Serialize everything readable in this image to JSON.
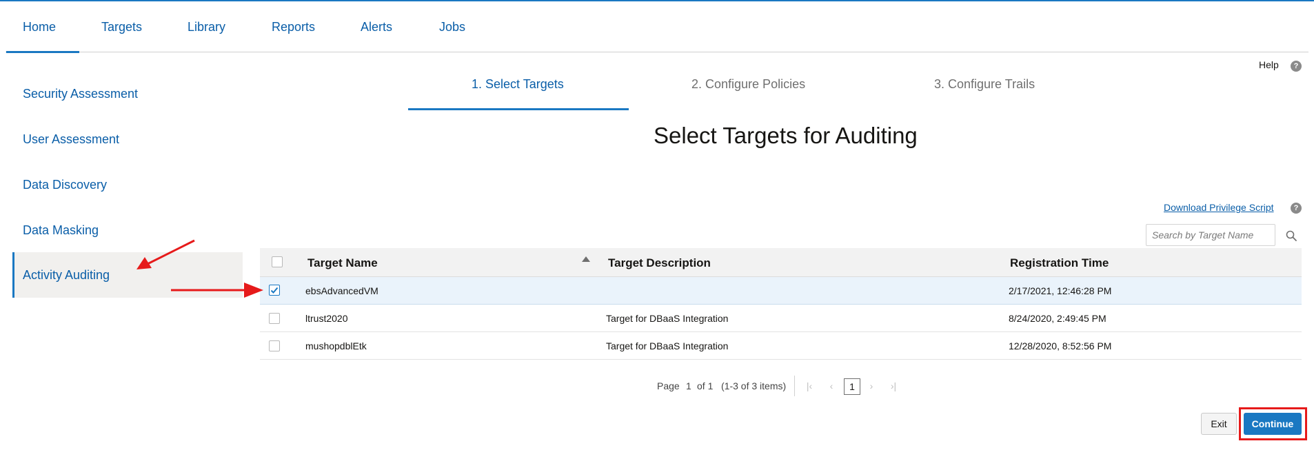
{
  "colors": {
    "accent": "#1a78c2",
    "link": "#0a5ea8",
    "annotation": "#e61a1a"
  },
  "nav": {
    "tabs": [
      {
        "label": "Home"
      },
      {
        "label": "Targets"
      },
      {
        "label": "Library"
      },
      {
        "label": "Reports"
      },
      {
        "label": "Alerts"
      },
      {
        "label": "Jobs"
      }
    ],
    "active": "Home"
  },
  "help": {
    "label": "Help",
    "icon": "help-icon"
  },
  "sidebar": {
    "items": [
      {
        "label": "Security Assessment"
      },
      {
        "label": "User Assessment"
      },
      {
        "label": "Data Discovery"
      },
      {
        "label": "Data Masking"
      },
      {
        "label": "Activity Auditing"
      }
    ],
    "active": "Activity Auditing"
  },
  "wizard": {
    "steps": [
      {
        "label": "1. Select Targets"
      },
      {
        "label": "2. Configure Policies"
      },
      {
        "label": "3. Configure Trails"
      }
    ],
    "active_step": 1
  },
  "main": {
    "title": "Select Targets for Auditing",
    "download_link": "Download Privilege Script",
    "search_placeholder": "Search by Target Name"
  },
  "table": {
    "headers": [
      "Target Name",
      "Target Description",
      "Registration Time"
    ],
    "sort_column": "Target Name",
    "sort_direction": "ascending",
    "rows": [
      {
        "name": "ebsAdvancedVM",
        "description": "",
        "time": "2/17/2021, 12:46:28 PM",
        "checked": true
      },
      {
        "name": "ltrust2020",
        "description": "Target for DBaaS Integration",
        "time": "8/24/2020, 2:49:45 PM",
        "checked": false
      },
      {
        "name": "mushopdblEtk",
        "description": "Target for DBaaS Integration",
        "time": "12/28/2020, 8:52:56 PM",
        "checked": false
      }
    ]
  },
  "pagination": {
    "page_label": "Page",
    "page": "1",
    "of_label": "of 1",
    "items_label": "(1-3 of 3 items)",
    "current": "1"
  },
  "buttons": {
    "exit": "Exit",
    "continue": "Continue"
  }
}
